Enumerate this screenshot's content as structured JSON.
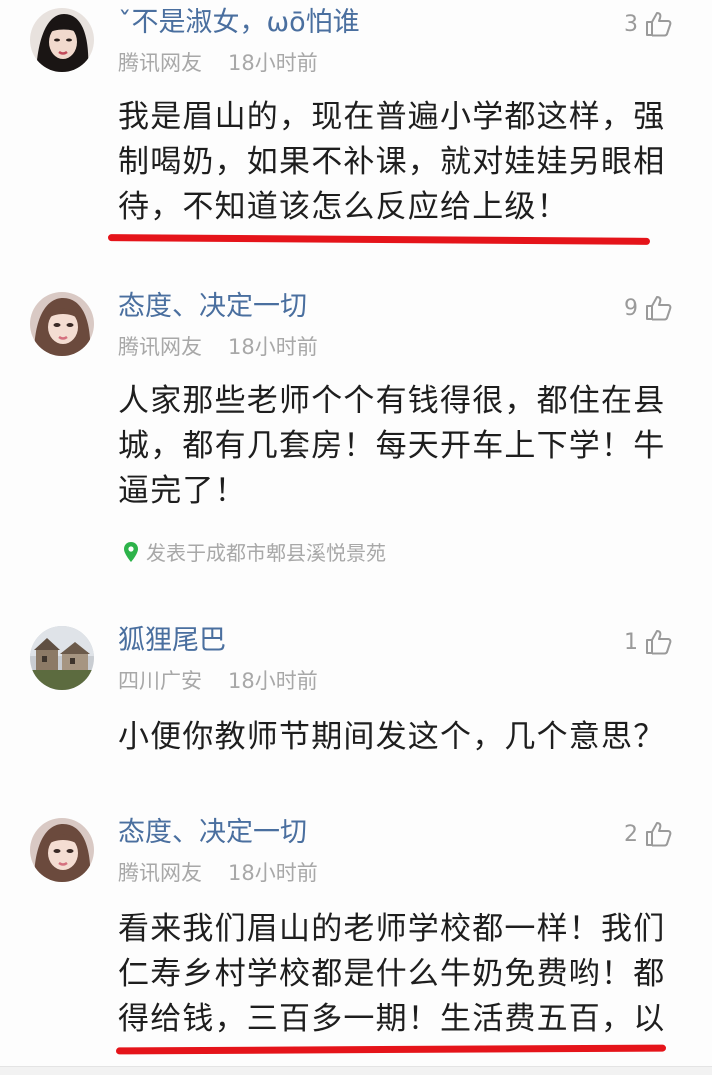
{
  "comments": [
    {
      "username": "ˇ不是淑女，ωō怕谁",
      "source": "腾讯网友",
      "time": "18小时前",
      "likes": "3",
      "lines": [
        "我是眉山的，现在普遍小学都这样，强",
        "制喝奶，如果不补课，就对娃娃另眼相",
        "待，不知道该怎么反应给上级！"
      ]
    },
    {
      "username": "态度、决定一切",
      "source": "腾讯网友",
      "time": "18小时前",
      "likes": "9",
      "lines": [
        "人家那些老师个个有钱得很，都住在县",
        "城，都有几套房！每天开车上下学！牛",
        "逼完了！"
      ],
      "location": "发表于成都市郫县溪悦景苑"
    },
    {
      "username": "狐狸尾巴",
      "source": "四川广安",
      "time": "18小时前",
      "likes": "1",
      "lines": [
        "小便你教师节期间发这个，几个意思？"
      ]
    },
    {
      "username": "态度、决定一切",
      "source": "腾讯网友",
      "time": "18小时前",
      "likes": "2",
      "lines": [
        "看来我们眉山的老师学校都一样！我们",
        "仁寿乡村学校都是什么牛奶免费哟！都",
        "得给钱，三百多一期！生活费五百，以"
      ]
    }
  ],
  "colors": {
    "username": "#4a6f9f",
    "meta": "#a8a8a8",
    "text": "#1e1e1e",
    "underline": "#e5141a",
    "location_pin": "#2db34a"
  },
  "icons": {
    "like": "thumbs-up-icon",
    "location": "location-pin-icon"
  }
}
